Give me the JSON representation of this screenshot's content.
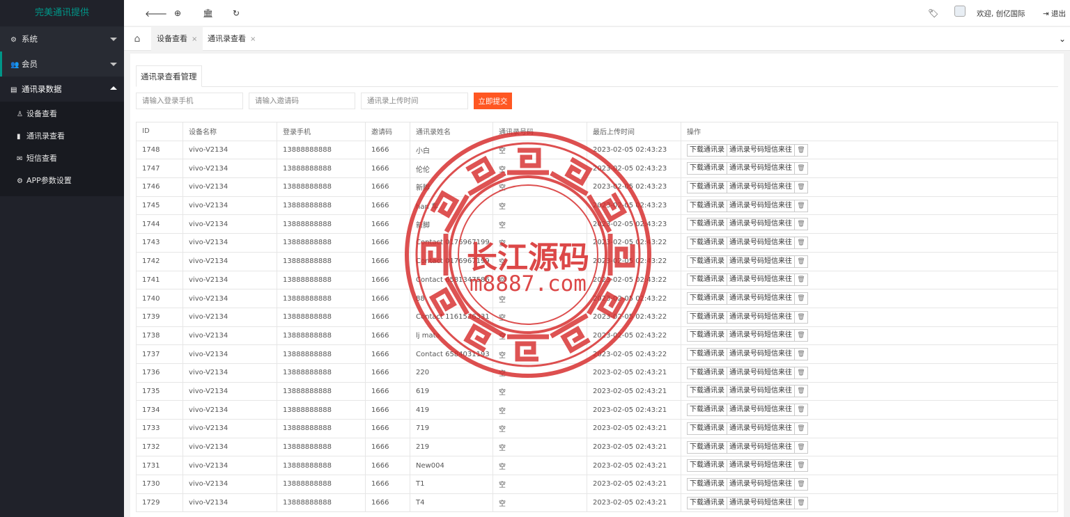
{
  "brand": "完美通讯提供",
  "topbar": {
    "welcome": "欢迎, 创亿国际",
    "logout": "退出"
  },
  "sidebar": {
    "groups": [
      {
        "label": "系统",
        "icon": "gear-icon"
      },
      {
        "label": "会员",
        "icon": "users-icon"
      },
      {
        "label": "通讯录数据",
        "icon": "id-card-icon"
      }
    ],
    "items": [
      {
        "label": "设备查看",
        "icon": "user-icon"
      },
      {
        "label": "通讯录查看",
        "icon": "book-icon"
      },
      {
        "label": "短信查看",
        "icon": "envelope-icon"
      },
      {
        "label": "APP参数设置",
        "icon": "gear-icon"
      }
    ]
  },
  "tabs": [
    {
      "label": "设备查看",
      "close": "×"
    },
    {
      "label": "通讯录查看",
      "close": "×"
    }
  ],
  "card": {
    "tab_label": "通讯录查看管理",
    "filters": {
      "phone_placeholder": "请输入登录手机",
      "invite_placeholder": "请输入邀请码",
      "time_placeholder": "通讯录上传时间"
    },
    "submit_label": "立即提交"
  },
  "table": {
    "columns": [
      "ID",
      "设备名称",
      "登录手机",
      "邀请码",
      "通讯录姓名",
      "通讯录号码",
      "最后上传时间",
      "操作"
    ],
    "actions": {
      "download": "下载通讯录",
      "sms": "通讯录号码短信来往",
      "delete_icon": "trash-icon"
    },
    "rows": [
      [
        "1748",
        "vivo-V2134",
        "13888888888",
        "1666",
        "小白",
        "空",
        "2023-02-05 02:43:23"
      ],
      [
        "1747",
        "vivo-V2134",
        "13888888888",
        "1666",
        "伦伦",
        "空",
        "2023-02-05 02:43:23"
      ],
      [
        "1746",
        "vivo-V2134",
        "13888888888",
        "1666",
        "新脚",
        "空",
        "2023-02-05 02:43:23"
      ],
      [
        "1745",
        "vivo-V2134",
        "13888888888",
        "1666",
        "han 车",
        "空",
        "2023-02-05 02:43:23"
      ],
      [
        "1744",
        "vivo-V2134",
        "13888888888",
        "1666",
        "新脚",
        "空",
        "2023-02-05 02:43:23"
      ],
      [
        "1743",
        "vivo-V2134",
        "13888888888",
        "1666",
        "Contact 0176967199",
        "空",
        "2023-02-05 02:43:22"
      ],
      [
        "1742",
        "vivo-V2134",
        "13888888888",
        "1666",
        "Contact 0176967199",
        "空",
        "2023-02-05 02:43:22"
      ],
      [
        "1741",
        "vivo-V2134",
        "13888888888",
        "1666",
        "Contact 6581347586",
        "空",
        "2023-02-05 02:43:22"
      ],
      [
        "1740",
        "vivo-V2134",
        "13888888888",
        "1666",
        "88",
        "空",
        "2023-02-05 02:43:22"
      ],
      [
        "1739",
        "vivo-V2134",
        "13888888888",
        "1666",
        "Contact 1161536331",
        "空",
        "2023-02-05 02:43:22"
      ],
      [
        "1738",
        "vivo-V2134",
        "13888888888",
        "1666",
        "lj mata",
        "空",
        "2023-02-05 02:43:22"
      ],
      [
        "1737",
        "vivo-V2134",
        "13888888888",
        "1666",
        "Contact 6584031193",
        "空",
        "2023-02-05 02:43:22"
      ],
      [
        "1736",
        "vivo-V2134",
        "13888888888",
        "1666",
        "220",
        "空",
        "2023-02-05 02:43:21"
      ],
      [
        "1735",
        "vivo-V2134",
        "13888888888",
        "1666",
        "619",
        "空",
        "2023-02-05 02:43:21"
      ],
      [
        "1734",
        "vivo-V2134",
        "13888888888",
        "1666",
        "419",
        "空",
        "2023-02-05 02:43:21"
      ],
      [
        "1733",
        "vivo-V2134",
        "13888888888",
        "1666",
        "719",
        "空",
        "2023-02-05 02:43:21"
      ],
      [
        "1732",
        "vivo-V2134",
        "13888888888",
        "1666",
        "219",
        "空",
        "2023-02-05 02:43:21"
      ],
      [
        "1731",
        "vivo-V2134",
        "13888888888",
        "1666",
        "New004",
        "空",
        "2023-02-05 02:43:21"
      ],
      [
        "1730",
        "vivo-V2134",
        "13888888888",
        "1666",
        "T1",
        "空",
        "2023-02-05 02:43:21"
      ],
      [
        "1729",
        "vivo-V2134",
        "13888888888",
        "1666",
        "T4",
        "空",
        "2023-02-05 02:43:21"
      ]
    ]
  },
  "watermark": {
    "title": "长江源码",
    "url": "m8887.com",
    "color": "#d62828"
  },
  "colors": {
    "sidebar_bg": "#20222a",
    "brand": "#009688",
    "submit": "#ff5722"
  }
}
